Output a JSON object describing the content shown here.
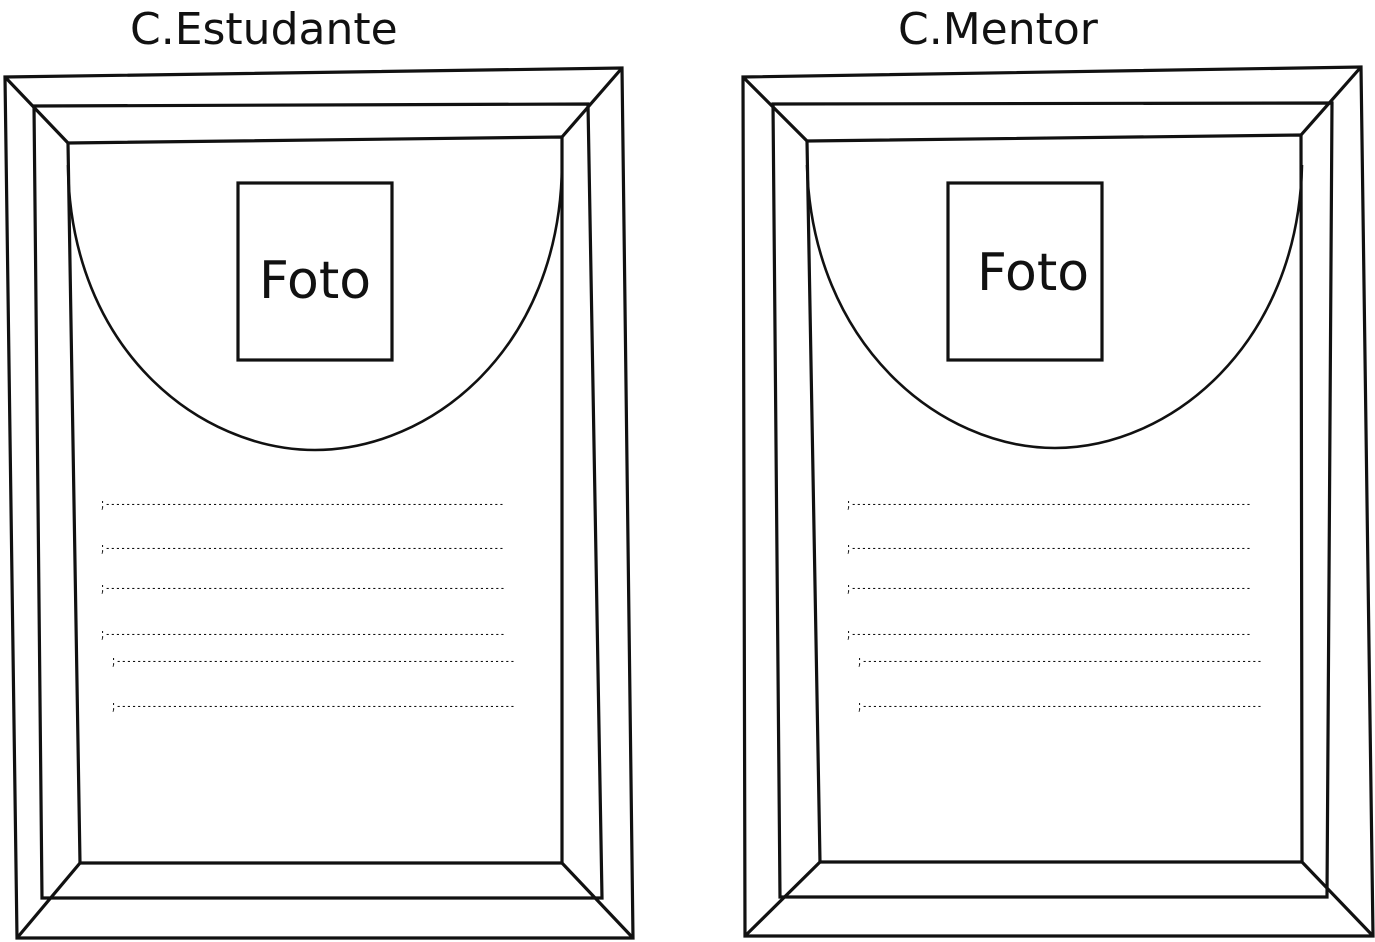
{
  "cards": [
    {
      "title": "C.Estudante",
      "photo_label": "Foto",
      "lines": [
        ";------------------------------------------------------------------------------",
        ";------------------------------------------------------------------------------",
        ";------------------------------------------------------------------------------",
        ";------------------------------------------------------------------------------",
        ";------------------------------------------------------------------------------",
        ";------------------------------------------------------------------------------"
      ]
    },
    {
      "title": "C.Mentor",
      "photo_label": "Foto",
      "lines": [
        ";------------------------------------------------------------------------------",
        ";------------------------------------------------------------------------------",
        ";------------------------------------------------------------------------------",
        ";------------------------------------------------------------------------------",
        ";------------------------------------------------------------------------------",
        ";------------------------------------------------------------------------------"
      ]
    }
  ]
}
